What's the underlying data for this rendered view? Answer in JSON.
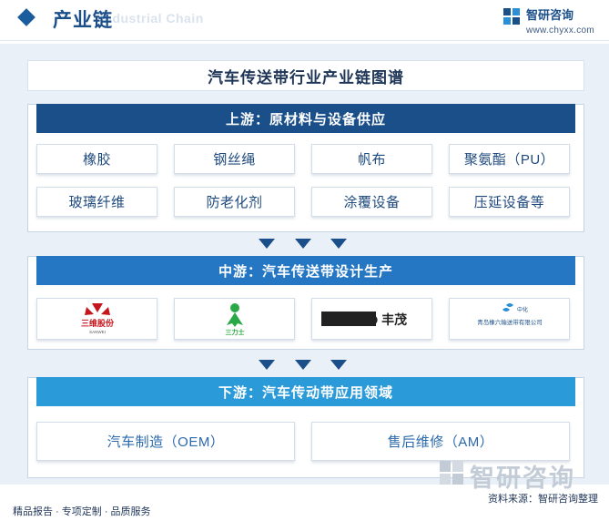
{
  "header": {
    "title": "产业链",
    "subtitle": "Industrial Chain",
    "brand_name": "智研咨询",
    "brand_url": "www.chyxx.com"
  },
  "chart_data": {
    "type": "diagram",
    "title": "汽车传送带行业产业链图谱",
    "stages": [
      {
        "name": "上游：原材料与设备供应",
        "items": [
          "橡胶",
          "钢丝绳",
          "帆布",
          "聚氨酯（PU）",
          "玻璃纤维",
          "防老化剂",
          "涂覆设备",
          "压延设备等"
        ]
      },
      {
        "name": "中游：汽车传送带设计生产",
        "logos": [
          {
            "text": "三维股份",
            "sub": "SANWEI",
            "color": "#c4161c"
          },
          {
            "text": "三力士",
            "color": "#2aa845"
          },
          {
            "text": "FIELD 丰茂",
            "color": "#222222"
          },
          {
            "text": "青岛橡六输送带有限公司",
            "top": "中化",
            "color": "#1b4f8a"
          }
        ]
      },
      {
        "name": "下游：汽车传动带应用领域",
        "items": [
          "汽车制造（OEM）",
          "售后维修（AM）"
        ]
      }
    ]
  },
  "footer": {
    "left": "精品报告 · 专项定制 · 品质服务",
    "source": "资料来源：智研咨询整理",
    "watermark": "智研咨询"
  },
  "colors": {
    "upstream": "#1b4f8a",
    "midstream": "#2577c4",
    "downstream": "#2a9ad8"
  }
}
